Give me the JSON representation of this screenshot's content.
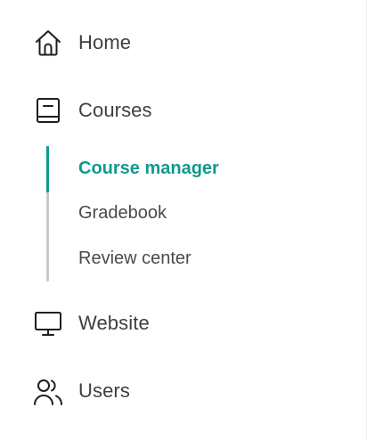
{
  "accent_color": "#0f9a8c",
  "nav": {
    "home": {
      "label": "Home",
      "icon": "home-icon"
    },
    "courses": {
      "label": "Courses",
      "icon": "book-icon",
      "subitems": [
        {
          "label": "Course manager",
          "active": true
        },
        {
          "label": "Gradebook",
          "active": false
        },
        {
          "label": "Review center",
          "active": false
        }
      ]
    },
    "website": {
      "label": "Website",
      "icon": "monitor-icon"
    },
    "users": {
      "label": "Users",
      "icon": "users-icon"
    }
  }
}
